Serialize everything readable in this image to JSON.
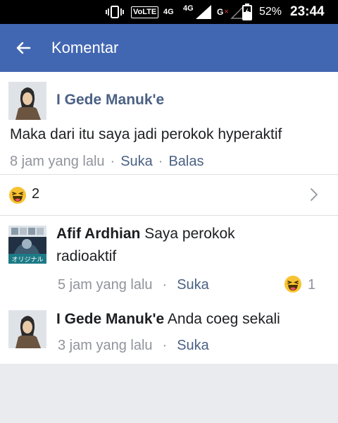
{
  "status_bar": {
    "volte": "VoLTE",
    "net1": "4G",
    "net2": "4G",
    "net3": "G",
    "battery": "52%",
    "time": "23:44"
  },
  "header": {
    "title": "Komentar",
    "back_icon": "arrow-left-icon"
  },
  "post": {
    "author": "I Gede Manuk'e",
    "text": "Maka dari itu saya jadi perokok hyperaktif",
    "time": "8 jam yang lalu",
    "like": "Suka",
    "reply": "Balas",
    "sep": "·"
  },
  "reactions": {
    "icon": "haha-emoji-icon",
    "count": "2"
  },
  "replies": [
    {
      "author": "Afif Ardhian",
      "text_line1": "Saya perokok",
      "text_line2": "radioaktif",
      "time": "5 jam yang lalu",
      "like": "Suka",
      "reaction_count": "1",
      "avatar_caption": "オリジナル"
    },
    {
      "author": "I Gede Manuk'e",
      "text_line1": "Anda coeg sekali",
      "time": "3 jam yang lalu",
      "like": "Suka"
    }
  ],
  "colors": {
    "brand": "#4267b2",
    "link": "#4b6184",
    "meta": "#90949c"
  }
}
